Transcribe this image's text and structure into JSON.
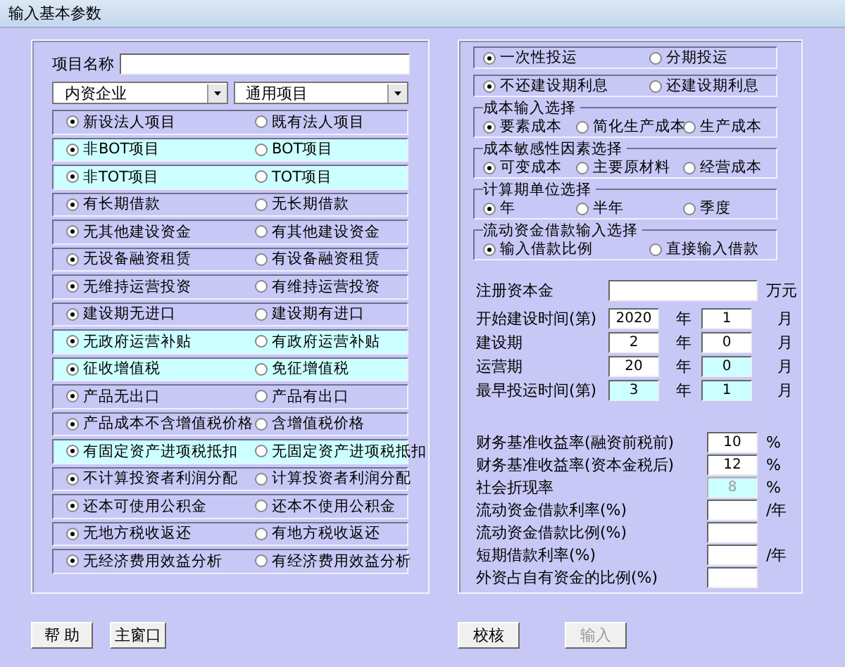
{
  "window": {
    "title": "输入基本参数"
  },
  "project_name": {
    "label": "项目名称"
  },
  "dropdowns": [
    {
      "value": "内资企业"
    },
    {
      "value": "通用项目"
    }
  ],
  "option_rows": [
    {
      "highlighted": false,
      "options": [
        {
          "label": "新设法人项目",
          "selected": true
        },
        {
          "label": "既有法人项目",
          "selected": false
        }
      ]
    },
    {
      "highlighted": true,
      "options": [
        {
          "label": "非BOT项目",
          "selected": true
        },
        {
          "label": "BOT项目",
          "selected": false
        }
      ]
    },
    {
      "highlighted": true,
      "options": [
        {
          "label": "非TOT项目",
          "selected": true
        },
        {
          "label": "TOT项目",
          "selected": false
        }
      ]
    },
    {
      "highlighted": false,
      "options": [
        {
          "label": "有长期借款",
          "selected": true
        },
        {
          "label": "无长期借款",
          "selected": false
        }
      ]
    },
    {
      "highlighted": false,
      "options": [
        {
          "label": "无其他建设资金",
          "selected": true
        },
        {
          "label": "有其他建设资金",
          "selected": false
        }
      ]
    },
    {
      "highlighted": false,
      "options": [
        {
          "label": "无设备融资租赁",
          "selected": true
        },
        {
          "label": "有设备融资租赁",
          "selected": false
        }
      ]
    },
    {
      "highlighted": false,
      "options": [
        {
          "label": "无维持运营投资",
          "selected": true
        },
        {
          "label": "有维持运营投资",
          "selected": false
        }
      ]
    },
    {
      "highlighted": false,
      "options": [
        {
          "label": "建设期无进口",
          "selected": true
        },
        {
          "label": "建设期有进口",
          "selected": false
        }
      ]
    },
    {
      "highlighted": true,
      "options": [
        {
          "label": "无政府运营补贴",
          "selected": true
        },
        {
          "label": "有政府运营补贴",
          "selected": false
        }
      ]
    },
    {
      "highlighted": true,
      "options": [
        {
          "label": "征收增值税",
          "selected": true
        },
        {
          "label": "免征增值税",
          "selected": false
        }
      ]
    },
    {
      "highlighted": false,
      "options": [
        {
          "label": "产品无出口",
          "selected": true
        },
        {
          "label": "产品有出口",
          "selected": false
        }
      ]
    },
    {
      "highlighted": false,
      "options": [
        {
          "label": "产品成本不含增值税价格",
          "selected": true
        },
        {
          "label": "含增值税价格",
          "selected": false
        }
      ]
    },
    {
      "highlighted": true,
      "options": [
        {
          "label": "有固定资产进项税抵扣",
          "selected": true
        },
        {
          "label": "无固定资产进项税抵扣",
          "selected": false
        }
      ]
    },
    {
      "highlighted": false,
      "options": [
        {
          "label": "不计算投资者利润分配",
          "selected": true
        },
        {
          "label": "计算投资者利润分配",
          "selected": false
        }
      ]
    },
    {
      "highlighted": false,
      "options": [
        {
          "label": "还本可使用公积金",
          "selected": true
        },
        {
          "label": "还本不使用公积金",
          "selected": false
        }
      ]
    },
    {
      "highlighted": false,
      "options": [
        {
          "label": "无地方税收返还",
          "selected": true
        },
        {
          "label": "有地方税收返还",
          "selected": false
        }
      ]
    },
    {
      "highlighted": false,
      "options": [
        {
          "label": "无经济费用效益分析",
          "selected": true
        },
        {
          "label": "有经济费用效益分析",
          "selected": false
        }
      ]
    }
  ],
  "option_groups": [
    {
      "options": [
        {
          "label": "一次性投运",
          "selected": true
        },
        {
          "label": "分期投运",
          "selected": false
        }
      ]
    },
    {
      "options": [
        {
          "label": "不还建设期利息",
          "selected": true
        },
        {
          "label": "还建设期利息",
          "selected": false
        }
      ]
    },
    {
      "title": "成本输入选择",
      "options": [
        {
          "label": "要素成本",
          "selected": true
        },
        {
          "label": "简化生产成本",
          "selected": false
        },
        {
          "label": "生产成本",
          "selected": false
        }
      ]
    },
    {
      "title": "成本敏感性因素选择",
      "options": [
        {
          "label": "可变成本",
          "selected": true
        },
        {
          "label": "主要原材料",
          "selected": false
        },
        {
          "label": "经营成本",
          "selected": false
        }
      ]
    },
    {
      "title": "计算期单位选择",
      "options": [
        {
          "label": "年",
          "selected": true
        },
        {
          "label": "半年",
          "selected": false
        },
        {
          "label": "季度",
          "selected": false
        }
      ]
    },
    {
      "title": "流动资金借款输入选择",
      "options": [
        {
          "label": "输入借款比例",
          "selected": true
        },
        {
          "label": "直接输入借款",
          "selected": false
        }
      ]
    }
  ],
  "capital": {
    "label": "注册资本金",
    "unit": "万元"
  },
  "period_rows": [
    {
      "label": "开始建设时间(第)",
      "year": {
        "value": "2020",
        "highlighted": false
      },
      "year_unit": "年",
      "month": {
        "value": "1",
        "highlighted": false
      },
      "month_unit": "月"
    },
    {
      "label": "建设期",
      "year": {
        "value": "2",
        "highlighted": false
      },
      "year_unit": "年",
      "month": {
        "value": "0",
        "highlighted": false
      },
      "month_unit": "月"
    },
    {
      "label": "运营期",
      "year": {
        "value": "20",
        "highlighted": false
      },
      "year_unit": "年",
      "month": {
        "value": "0",
        "highlighted": true
      },
      "month_unit": "月"
    },
    {
      "label": "最早投运时间(第)",
      "year": {
        "value": "3",
        "highlighted": true
      },
      "year_unit": "年",
      "month": {
        "value": "1",
        "highlighted": true
      },
      "month_unit": "月"
    }
  ],
  "rate_rows": [
    {
      "label": "财务基准收益率(融资前税前)",
      "value": "10",
      "highlighted": false,
      "disabled": false,
      "unit": "%"
    },
    {
      "label": "财务基准收益率(资本金税后)",
      "value": "12",
      "highlighted": false,
      "disabled": false,
      "unit": "%"
    },
    {
      "label": "社会折现率",
      "value": "8",
      "highlighted": true,
      "disabled": true,
      "unit": "%"
    },
    {
      "label": "流动资金借款利率(%)",
      "highlighted": false,
      "disabled": false,
      "unit": "/年"
    },
    {
      "label": "流动资金借款比例(%)",
      "highlighted": false,
      "disabled": false
    },
    {
      "label": "短期借款利率(%)",
      "highlighted": false,
      "disabled": false,
      "unit": "/年"
    },
    {
      "label": "外资占自有资金的比例(%)",
      "highlighted": false,
      "disabled": false
    }
  ],
  "left_buttons": [
    {
      "label": "帮 助",
      "disabled": false
    },
    {
      "label": "主窗口",
      "disabled": false
    }
  ],
  "right_buttons": [
    {
      "label": "校核",
      "disabled": false
    },
    {
      "label": "输入",
      "disabled": true
    }
  ]
}
